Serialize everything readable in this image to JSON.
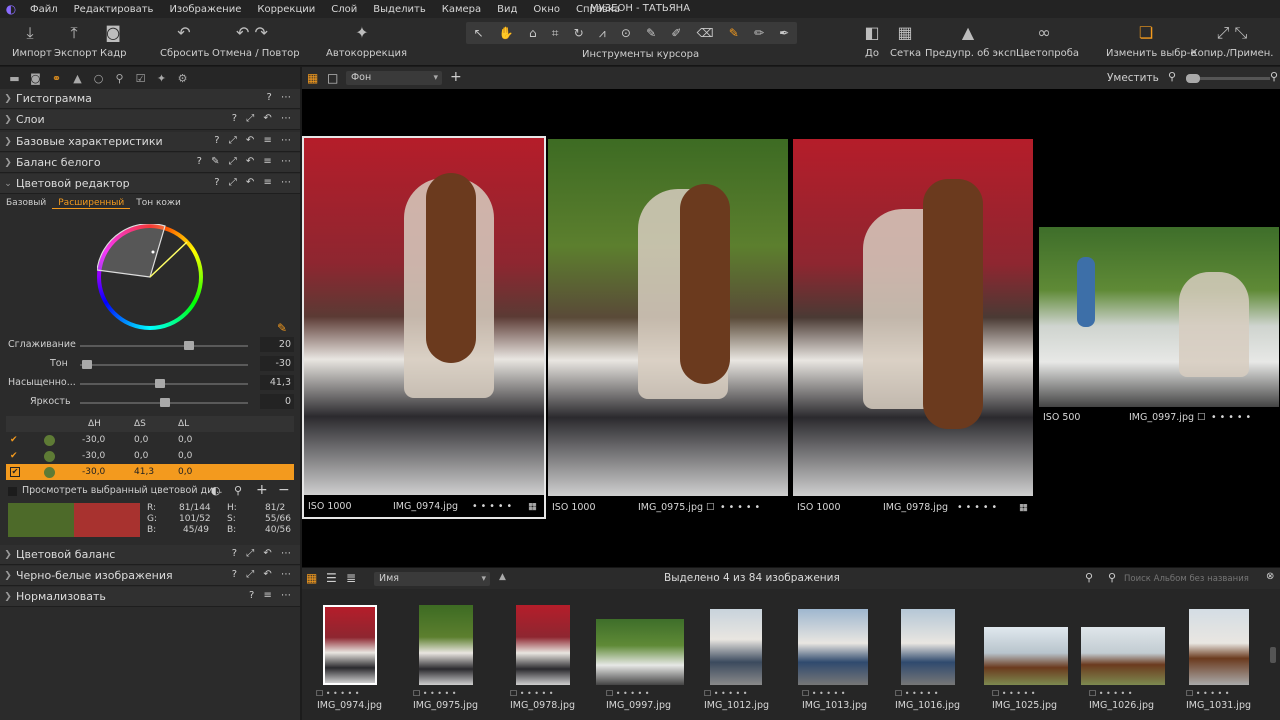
{
  "app": {
    "window_title": "МУЗЕОН - ТАТЬЯНА"
  },
  "menu": [
    "Файл",
    "Редактировать",
    "Изображение",
    "Коррекции",
    "Слой",
    "Выделить",
    "Камера",
    "Вид",
    "Окно",
    "Справка"
  ],
  "toolbar": {
    "import": "Импорт",
    "export": "Экспорт",
    "frame": "Кадр",
    "reset": "Сбросить",
    "undo_redo": "Отмена / Повтор",
    "autocorrect": "Автокоррекция",
    "cursor_tools": "Инструменты курсора",
    "before": "До",
    "grid": "Сетка",
    "exposure_warning": "Предупр. об эксп.",
    "color_proof": "Цветопроба",
    "change_selection": "Изменить выбр-е",
    "copy_apply": "Копир./Примен."
  },
  "tools": {
    "sections": {
      "histogram": "Гистограмма",
      "layers": "Слои",
      "base_characteristics": "Базовые характеристики",
      "white_balance": "Баланс белого",
      "color_editor": "Цветовой редактор",
      "color_balance": "Цветовой баланс",
      "bw": "Черно-белые изображения",
      "normalize": "Нормализовать"
    },
    "color_editor_tabs": {
      "basic": "Базовый",
      "advanced": "Расширенный",
      "skin": "Тон кожи"
    },
    "sliders": [
      {
        "label": "Сглаживание",
        "value": "20",
        "pos": 0.65
      },
      {
        "label": "Тон",
        "value": "-30",
        "pos": 0.03
      },
      {
        "label": "Насыщенно...",
        "value": "41,3",
        "pos": 0.47
      },
      {
        "label": "Яркость",
        "value": "0",
        "pos": 0.5
      }
    ],
    "table_headers": {
      "dh": "ΔH",
      "ds": "ΔS",
      "dl": "ΔL"
    },
    "table_rows": [
      {
        "dh": "-30,0",
        "ds": "0,0",
        "dl": "0,0",
        "selected": false
      },
      {
        "dh": "-30,0",
        "ds": "0,0",
        "dl": "0,0",
        "selected": false
      },
      {
        "dh": "-30,0",
        "ds": "41,3",
        "dl": "0,0",
        "selected": true
      }
    ],
    "preview_label": "Просмотреть выбранный цветовой ди...",
    "swatches": [
      "#4d6a29",
      "#a8322f"
    ],
    "rgb": {
      "r_label": "R:",
      "r": "81/144",
      "g_label": "G:",
      "g": "101/52",
      "b_label": "B:",
      "b": "45/49",
      "h_label": "H:",
      "h": "81/2",
      "s_label": "S:",
      "s": "55/66",
      "bb_label": "B:",
      "bb": "40/56"
    }
  },
  "viewer": {
    "layer_select": "Фон",
    "fit": "Уместить",
    "photos": [
      {
        "iso": "ISO 1000",
        "name": "IMG_0974.jpg"
      },
      {
        "iso": "ISO 1000",
        "name": "IMG_0975.jpg"
      },
      {
        "iso": "ISO 1000",
        "name": "IMG_0978.jpg"
      },
      {
        "iso": "ISO 500",
        "name": "IMG_0997.jpg"
      }
    ]
  },
  "browser": {
    "sort": "Имя",
    "status": "Выделено 4 из 84 изображения",
    "search_placeholder": "Поиск Альбом без названия",
    "thumbs": [
      "IMG_0974.jpg",
      "IMG_0975.jpg",
      "IMG_0978.jpg",
      "IMG_0997.jpg",
      "IMG_1012.jpg",
      "IMG_1013.jpg",
      "IMG_1016.jpg",
      "IMG_1025.jpg",
      "IMG_1026.jpg",
      "IMG_1031.jpg"
    ]
  },
  "colors": {
    "accent": "#f39a1e",
    "selected_row": "#f39a1e"
  }
}
